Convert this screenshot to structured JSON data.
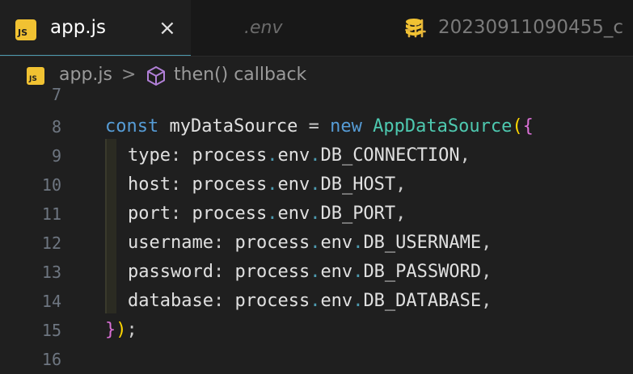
{
  "tabs": [
    {
      "icon_text": "JS",
      "label": "app.js",
      "close": "×"
    },
    {
      "icon": "sliders-icon",
      "label": ".env"
    },
    {
      "icon": "database-icon",
      "label": "20230911090455_c"
    }
  ],
  "breadcrumb": {
    "icon_text": "JS",
    "file": "app.js",
    "separator": ">",
    "symbol": "then() callback"
  },
  "editor": {
    "lines": [
      {
        "num": "7"
      },
      {
        "num": "8"
      },
      {
        "num": "9"
      },
      {
        "num": "10"
      },
      {
        "num": "11"
      },
      {
        "num": "12"
      },
      {
        "num": "13"
      },
      {
        "num": "14"
      },
      {
        "num": "15"
      },
      {
        "num": "16"
      }
    ],
    "l8": {
      "const": "const",
      "name": " myDataSource ",
      "eq": "=",
      "new": " new ",
      "cls": "AppDataSource",
      "paren": "(",
      "brace": "{"
    },
    "l9": {
      "key": "type",
      "colon": ": ",
      "obj": "process",
      "d1": ".",
      "env": "env",
      "d2": ".",
      "val": "DB_CONNECTION",
      "comma": ","
    },
    "l10": {
      "key": "host",
      "colon": ": ",
      "obj": "process",
      "d1": ".",
      "env": "env",
      "d2": ".",
      "val": "DB_HOST",
      "comma": ","
    },
    "l11": {
      "key": "port",
      "colon": ": ",
      "obj": "process",
      "d1": ".",
      "env": "env",
      "d2": ".",
      "val": "DB_PORT",
      "comma": ","
    },
    "l12": {
      "key": "username",
      "colon": ": ",
      "obj": "process",
      "d1": ".",
      "env": "env",
      "d2": ".",
      "val": "DB_USERNAME",
      "comma": ","
    },
    "l13": {
      "key": "password",
      "colon": ": ",
      "obj": "process",
      "d1": ".",
      "env": "env",
      "d2": ".",
      "val": "DB_PASSWORD",
      "comma": ","
    },
    "l14": {
      "key": "database",
      "colon": ": ",
      "obj": "process",
      "d1": ".",
      "env": "env",
      "d2": ".",
      "val": "DB_DATABASE",
      "comma": ","
    },
    "l15": {
      "brace": "}",
      "paren": ")",
      "semi": ";"
    },
    "hint_dots": "..."
  },
  "colors": {
    "background": "#1f1f1f",
    "active_tab_border": "#4d9bb0",
    "js_badge": "#f1c232",
    "keyword": "#c586c0",
    "class_name": "#4ec9b0"
  }
}
